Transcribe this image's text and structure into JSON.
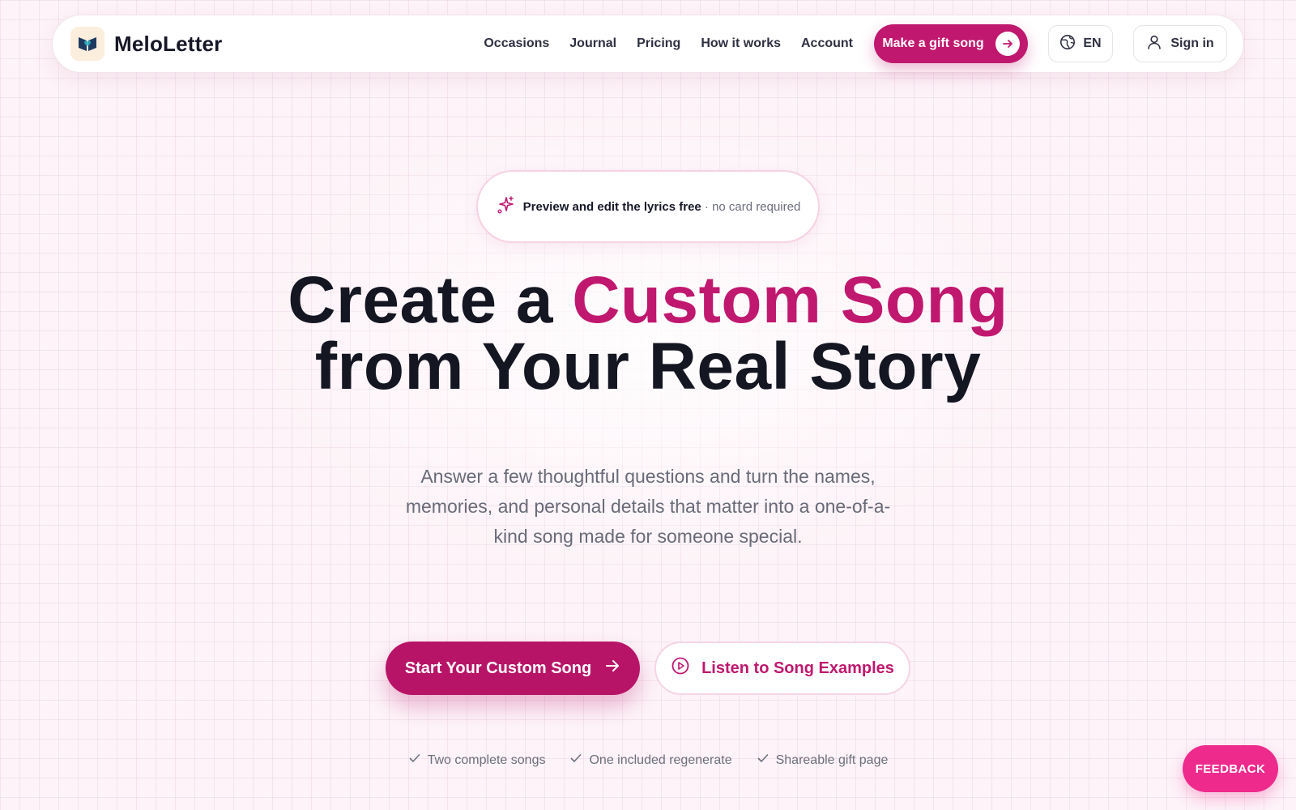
{
  "brand": {
    "name": "MeloLetter",
    "accent_color": "#c0186f",
    "cta_color": "#b81467",
    "feedback_color": "#ee2a8d"
  },
  "nav": {
    "links": [
      "Occasions",
      "Journal",
      "Pricing",
      "How it works",
      "Account"
    ],
    "gift_button_label": "Make a gift song",
    "language_label": "EN",
    "signin_label": "Sign in"
  },
  "badge": {
    "strong_text": "Preview and edit the lyrics free",
    "muted_text": "· no card required",
    "icon": "sparkles-icon"
  },
  "hero": {
    "headline_part1": "Create a ",
    "headline_accent": "Custom Song",
    "headline_line2": "from Your Real Story",
    "subheadline": "Answer a few thoughtful questions and turn the names, memories, and personal details that matter into a one-of-a-kind song made for someone special."
  },
  "cta": {
    "primary_label": "Start Your Custom Song",
    "secondary_label": "Listen to Song Examples"
  },
  "features": [
    "Two complete songs",
    "One included regenerate",
    "Shareable gift page"
  ],
  "feedback_label": "FEEDBACK"
}
